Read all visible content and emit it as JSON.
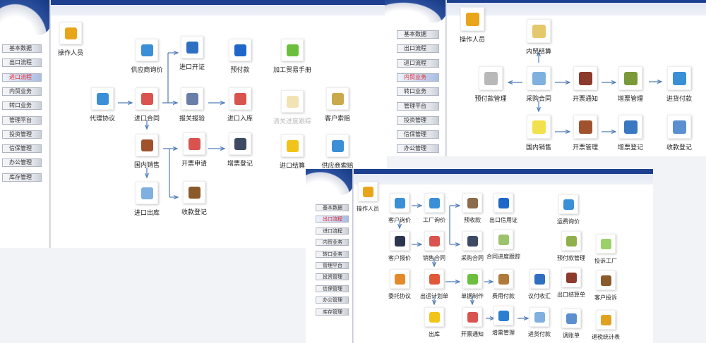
{
  "panels": [
    {
      "id": "import",
      "sidebar": [
        "基本数据",
        "出口流程",
        "进口流程",
        "内贸业务",
        "转口业务",
        "管理平台",
        "投资管理",
        "信保管理",
        "办公管理",
        "库存管理"
      ],
      "selected": 2,
      "nodes": [
        {
          "label": "操作人员",
          "icon": "worker-icon",
          "color": "#e9a51a"
        },
        {
          "label": "供应商询价",
          "icon": "document-globe-icon",
          "color": "#3a8fd6"
        },
        {
          "label": "进口开证",
          "icon": "user-icon",
          "color": "#2f6fc2"
        },
        {
          "label": "预付款",
          "icon": "book-info-icon",
          "color": "#1f66c9"
        },
        {
          "label": "加工贸易手册",
          "icon": "money-icon",
          "color": "#6cbf3c"
        },
        {
          "label": "代理协议",
          "icon": "document-globe-icon",
          "color": "#3a8fd6"
        },
        {
          "label": "进口合同",
          "icon": "globe-contract-icon",
          "color": "#d9534f"
        },
        {
          "label": "报关报验",
          "icon": "machine-icon",
          "color": "#6a7fa8"
        },
        {
          "label": "进口入库",
          "icon": "globe-contract-icon",
          "color": "#d9534f"
        },
        {
          "label": "清关进度跟踪",
          "icon": "calendar-clock-icon",
          "color": "#e5c86b",
          "dim": true
        },
        {
          "label": "客户索赔",
          "icon": "pen-paper-icon",
          "color": "#c9a94a"
        },
        {
          "label": "国内销售",
          "icon": "stopwatch-icon",
          "color": "#a0522d"
        },
        {
          "label": "开票申请",
          "icon": "map-pin-icon",
          "color": "#d9534f"
        },
        {
          "label": "增票登记",
          "icon": "safe-search-icon",
          "color": "#3c4a63"
        },
        {
          "label": "进口结算",
          "icon": "notebook-icon",
          "color": "#f0c419"
        },
        {
          "label": "供应商索赔",
          "icon": "monitor-chart-icon",
          "color": "#3a8fd6"
        },
        {
          "label": "进口出库",
          "icon": "certificate-icon",
          "color": "#7fb0e0"
        },
        {
          "label": "收款登记",
          "icon": "box-hands-icon",
          "color": "#8b5a2b"
        }
      ]
    },
    {
      "id": "domestic",
      "sidebar": [
        "基本数据",
        "出口流程",
        "进口流程",
        "内贸业务",
        "转口业务",
        "管理平台",
        "投资管理",
        "信保管理",
        "办公管理"
      ],
      "selected": 3,
      "nodes": [
        {
          "label": "操作人员",
          "icon": "worker-icon",
          "color": "#e9a51a"
        },
        {
          "label": "内贸结算",
          "icon": "calendar-clock-icon",
          "color": "#e5c86b"
        },
        {
          "label": "预付款管理",
          "icon": "document-icon",
          "color": "#b8b8b8"
        },
        {
          "label": "采购合同",
          "icon": "certificate-icon",
          "color": "#7fb0e0"
        },
        {
          "label": "开票通知",
          "icon": "wallet-icon",
          "color": "#8b3a2b"
        },
        {
          "label": "增票管理",
          "icon": "money-stack-icon",
          "color": "#7a9a3a"
        },
        {
          "label": "进货付款",
          "icon": "warning-icon",
          "color": "#3a8fd6"
        },
        {
          "label": "国内销售",
          "icon": "sticky-notes-icon",
          "color": "#f2e14c"
        },
        {
          "label": "开票管理",
          "icon": "clipboard-icon",
          "color": "#a0522d"
        },
        {
          "label": "增票登记",
          "icon": "binders-icon",
          "color": "#3b78c4"
        },
        {
          "label": "收款登记",
          "icon": "sign-form-icon",
          "color": "#5c8fd0"
        }
      ]
    },
    {
      "id": "export",
      "sidebar": [
        "基本数据",
        "出口流程",
        "进口流程",
        "内贸业务",
        "转口业务",
        "管理平台",
        "投资管理",
        "信保管理",
        "办公管理",
        "库存管理"
      ],
      "selected": 1,
      "nodes": [
        {
          "label": "操作人员",
          "icon": "worker-icon",
          "color": "#e9a51a"
        },
        {
          "label": "客户询价",
          "icon": "document-globe-icon",
          "color": "#3a8fd6"
        },
        {
          "label": "工厂询价",
          "icon": "document-globe-icon",
          "color": "#3a8fd6"
        },
        {
          "label": "预收款",
          "icon": "box-icon",
          "color": "#8b6b4a"
        },
        {
          "label": "出口信用证",
          "icon": "book-info-icon",
          "color": "#1f66c9"
        },
        {
          "label": "运费询价",
          "icon": "document-globe-icon",
          "color": "#3a8fd6"
        },
        {
          "label": "客户报价",
          "icon": "tools-icon",
          "color": "#2b3550"
        },
        {
          "label": "销售合同",
          "icon": "globe-contract-icon",
          "color": "#d9534f"
        },
        {
          "label": "采购合同",
          "icon": "safe-search-icon",
          "color": "#3c4a63"
        },
        {
          "label": "合同进度跟踪",
          "icon": "chart-doc-icon",
          "color": "#9cc26a"
        },
        {
          "label": "预付款管理",
          "icon": "money-hand-icon",
          "color": "#8fb04a"
        },
        {
          "label": "投诉工厂",
          "icon": "checklist-icon",
          "color": "#9cd06a"
        },
        {
          "label": "委托协议",
          "icon": "sign-form-icon",
          "color": "#e58a2a"
        },
        {
          "label": "出运计划单",
          "icon": "people-icon",
          "color": "#e05a3a"
        },
        {
          "label": "单据制作",
          "icon": "money-icon",
          "color": "#6cbf3c"
        },
        {
          "label": "费用付款",
          "icon": "box-coins-icon",
          "color": "#b07a3a"
        },
        {
          "label": "议付收汇",
          "icon": "user-icon",
          "color": "#2f6fc2"
        },
        {
          "label": "出口结算单",
          "icon": "wallet-icon",
          "color": "#8b3a2b"
        },
        {
          "label": "客户投诉",
          "icon": "box-hands-icon",
          "color": "#8b5a2b"
        },
        {
          "label": "出库",
          "icon": "notebook-icon",
          "color": "#f0c419"
        },
        {
          "label": "开票通知",
          "icon": "map-pin-icon",
          "color": "#d9534f"
        },
        {
          "label": "增票管理",
          "icon": "laptop-dollar-icon",
          "color": "#2b7fd0"
        },
        {
          "label": "进货付款",
          "icon": "document-pen-icon",
          "color": "#7fb0e0"
        },
        {
          "label": "调账单",
          "icon": "sign-form-icon",
          "color": "#5c8fd0"
        },
        {
          "label": "退税统计表",
          "icon": "user-chat-icon",
          "color": "#e0a020"
        }
      ]
    }
  ]
}
